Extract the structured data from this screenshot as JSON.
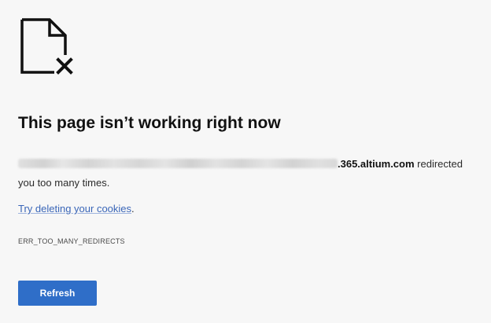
{
  "icon": "broken-page-icon",
  "title": "This page isn’t working right now",
  "message": {
    "host_suffix": ".365.altium.com",
    "text_after_host": " redirected",
    "text_line2": "you too many times."
  },
  "suggestion": {
    "link_text": "Try deleting your cookies",
    "trailing": "."
  },
  "error_code": "ERR_TOO_MANY_REDIRECTS",
  "refresh_button": {
    "label": "Refresh",
    "color": "#2f6ec8"
  }
}
